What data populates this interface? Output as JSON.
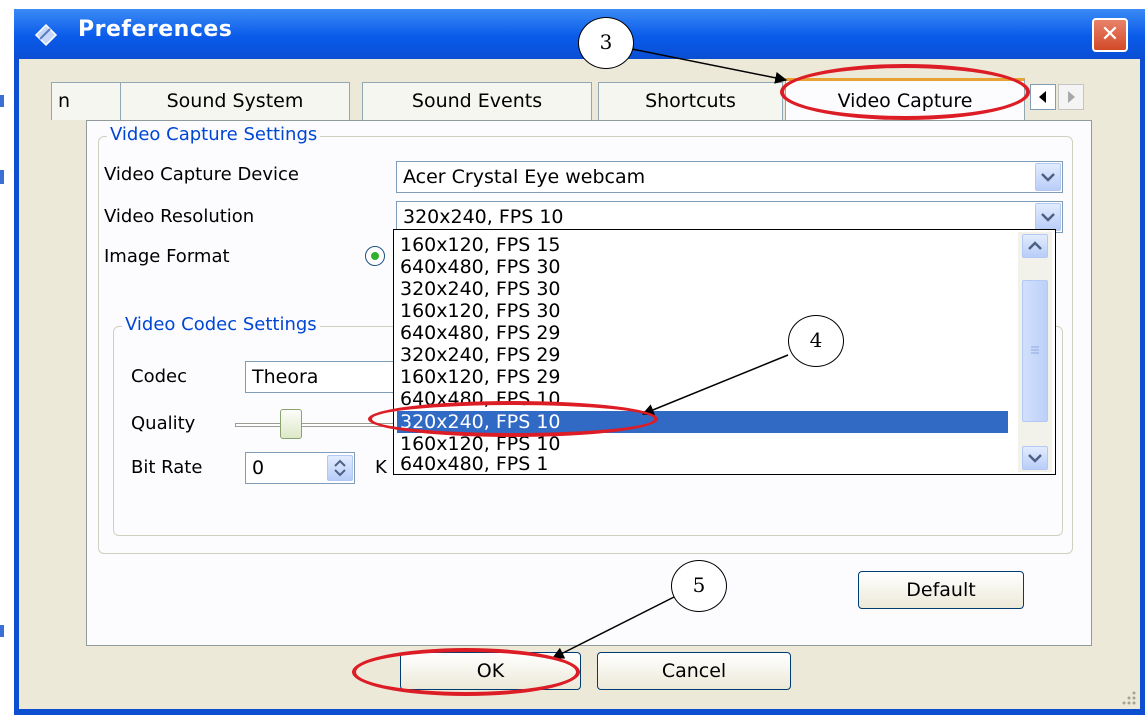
{
  "window": {
    "title": "Preferences",
    "close_glyph": "✕"
  },
  "tabs": [
    "n",
    "Sound System",
    "Sound Events",
    "Shortcuts",
    "Video Capture"
  ],
  "tab_scroll": {
    "left": "◀",
    "right": "▶"
  },
  "capture_settings": {
    "group_title": "Video Capture Settings",
    "device_label": "Video Capture Device",
    "device_value": "Acer Crystal Eye webcam",
    "resolution_label": "Video Resolution",
    "resolution_value": "320x240, FPS 10",
    "image_format_label": "Image Format"
  },
  "resolution_options": [
    "160x120, FPS 15",
    "640x480, FPS 30",
    "320x240, FPS 30",
    "160x120, FPS 30",
    "640x480, FPS 29",
    "320x240, FPS 29",
    "160x120, FPS 29",
    "640x480, FPS 10",
    "320x240, FPS 10",
    "160x120, FPS 10",
    "640x480, FPS 1"
  ],
  "selected_option": "320x240, FPS 10",
  "codec_settings": {
    "group_title": "Video Codec Settings",
    "codec_label": "Codec",
    "codec_value": "Theora",
    "quality_label": "Quality",
    "bitrate_label": "Bit Rate",
    "bitrate_value": "0",
    "bitrate_unit": "K"
  },
  "buttons": {
    "default": "Default",
    "ok": "OK",
    "cancel": "Cancel"
  },
  "callouts": [
    "3",
    "4",
    "5"
  ],
  "colors": {
    "highlight": "#316ac5",
    "annotation": "#dd1d25",
    "title_bar": "#0a5bea"
  }
}
